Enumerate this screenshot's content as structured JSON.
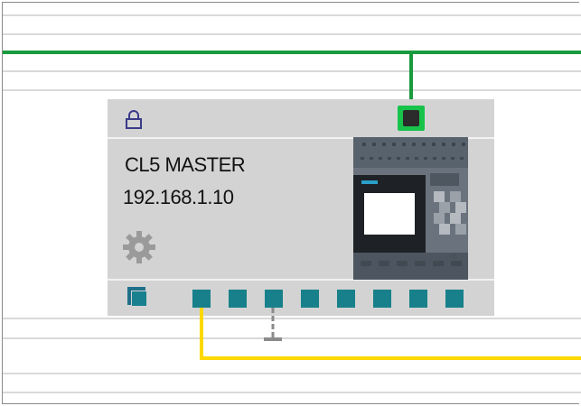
{
  "device": {
    "name": "CL5 MASTER",
    "ip": "192.168.1.10",
    "icons": [
      "lock-icon",
      "gear-icon",
      "copy-icon",
      "plc-image"
    ]
  },
  "ports": {
    "network_port_color": "#17c34a",
    "io_port_color": "#17808a",
    "io_port_count": 8
  },
  "colors": {
    "profinet_bus": "#1a9a3e",
    "io_bus": "#ffd800",
    "device_bg": "#d3d3d3",
    "plc_body": "#5b6570"
  }
}
